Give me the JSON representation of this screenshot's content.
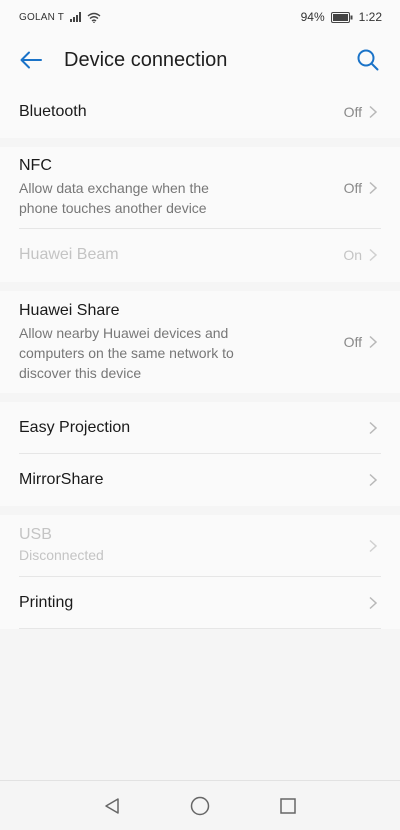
{
  "status_bar": {
    "carrier": "GOLAN T",
    "battery_percent": "94%",
    "time": "1:22"
  },
  "header": {
    "title": "Device connection"
  },
  "groups": [
    {
      "items": [
        {
          "title": "Bluetooth",
          "value": "Off"
        }
      ]
    },
    {
      "items": [
        {
          "title": "NFC",
          "subtitle": "Allow data exchange when the phone touches another device",
          "value": "Off"
        },
        {
          "title": "Huawei Beam",
          "value": "On",
          "disabled": true
        }
      ]
    },
    {
      "items": [
        {
          "title": "Huawei Share",
          "subtitle": "Allow nearby Huawei devices and computers on the same network to discover this device",
          "value": "Off"
        }
      ]
    },
    {
      "items": [
        {
          "title": "Easy Projection"
        },
        {
          "title": "MirrorShare"
        }
      ]
    },
    {
      "items": [
        {
          "title": "USB",
          "subtitle": "Disconnected",
          "disabled": true
        },
        {
          "title": "Printing"
        }
      ]
    }
  ],
  "colors": {
    "accent": "#1a73c8",
    "background": "#f5f5f5",
    "surface": "#fafafa"
  },
  "icons": {
    "back": "arrow-left-icon",
    "search": "search-icon",
    "chevron": "chevron-right-icon",
    "nav_back": "triangle-back-icon",
    "nav_home": "circle-home-icon",
    "nav_recents": "square-recents-icon"
  }
}
